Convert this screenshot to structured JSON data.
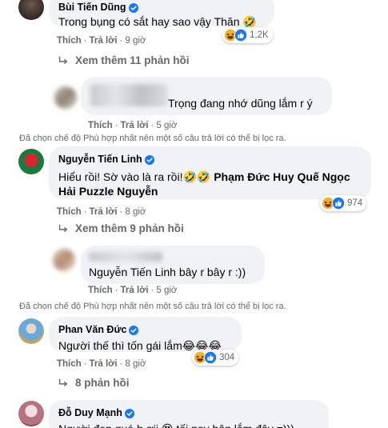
{
  "comments": [
    {
      "author": "Bùi Tiến Dũng",
      "text": "Trong bụng có sắt hay sao vậy Thăn",
      "emoji": "🤣",
      "like": "Thích",
      "reply": "Trả lời",
      "time": "9 giờ",
      "reaction_count": "1,2K",
      "more_replies": "Xem thêm 11 phản hồi"
    },
    {
      "text": "Trọng đang nhớ dũng lắm r ý",
      "like": "Thích",
      "reply": "Trả lời",
      "time": "5 giờ",
      "filter_notice": "Đã chọn chế độ Phù hợp nhất nên một số câu trả lời có thể bị lọc ra."
    },
    {
      "author": "Nguyễn Tiến Linh",
      "text_line1": "Hiểu rồi! Sờ vào là ra rồi!🤣🤣 ",
      "mention1": "Phạm Đức Huy",
      "mention2": "Quế Ngọc",
      "mention3": "Hải",
      "mention4": "Puzzle Nguyễn",
      "like": "Thích",
      "reply": "Trả lời",
      "time": "8 giờ",
      "reaction_count": "974",
      "more_replies": "Xem thêm 9 phản hồi"
    },
    {
      "mention": "Nguyễn Tiến Linh",
      "text": " bây r bây r :))",
      "like": "Thích",
      "reply": "Trả lời",
      "time": "5 giờ",
      "filter_notice": "Đã chọn chế độ Phù hợp nhất nên một số câu trả lời có thể bị lọc ra."
    },
    {
      "author": "Phan Văn Đức",
      "text": "Người thế thì tốn gái lắm😂😂😂",
      "like": "Thích",
      "reply": "Trả lời",
      "time": "8 giờ",
      "reaction_count": "304",
      "more_replies": "8 phản hồi"
    },
    {
      "author": "Đỗ Duy Mạnh",
      "text": "Người đẹp quá b ơii 😍 tối nay bận lắm đây =)))"
    }
  ],
  "colors": {
    "bubble": "#f0f2f5",
    "verified": "#1877f2",
    "secondary_text": "#65676b",
    "like_blue": "#1877f2",
    "haha_yellow": "#f7b125"
  },
  "separator": "·"
}
